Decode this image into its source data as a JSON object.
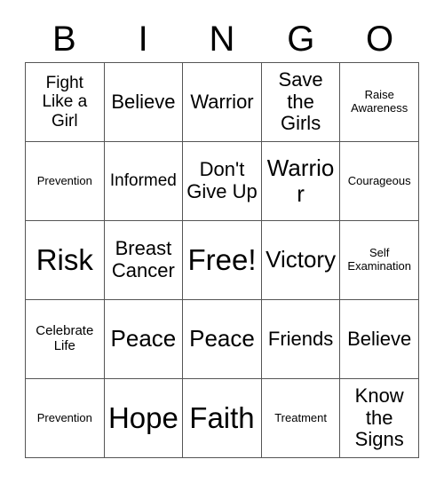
{
  "header": {
    "letters": [
      "B",
      "I",
      "N",
      "G",
      "O"
    ]
  },
  "grid": {
    "rows": 5,
    "columns": 5,
    "border_color": "#555555",
    "background_color": "#ffffff",
    "text_color": "#000000",
    "cells": [
      {
        "text": "Fight Like a Girl",
        "size": "m",
        "free": false
      },
      {
        "text": "Believe",
        "size": "l",
        "free": false
      },
      {
        "text": "Warrior",
        "size": "l",
        "free": false
      },
      {
        "text": "Save the Girls",
        "size": "l",
        "free": false
      },
      {
        "text": "Raise Awareness",
        "size": "xs",
        "free": false
      },
      {
        "text": "Prevention",
        "size": "xs",
        "free": false
      },
      {
        "text": "Informed",
        "size": "m",
        "free": false
      },
      {
        "text": "Don't Give Up",
        "size": "l",
        "free": false
      },
      {
        "text": "Warrior",
        "size": "xl",
        "free": false
      },
      {
        "text": "Courageous",
        "size": "xs",
        "free": false
      },
      {
        "text": "Risk",
        "size": "xxl",
        "free": false
      },
      {
        "text": "Breast Cancer",
        "size": "l",
        "free": false
      },
      {
        "text": "Free!",
        "size": "xxl",
        "free": true
      },
      {
        "text": "Victory",
        "size": "xl",
        "free": false
      },
      {
        "text": "Self Examination",
        "size": "xs",
        "free": false
      },
      {
        "text": "Celebrate Life",
        "size": "s",
        "free": false
      },
      {
        "text": "Peace",
        "size": "xl",
        "free": false
      },
      {
        "text": "Peace",
        "size": "xl",
        "free": false
      },
      {
        "text": "Friends",
        "size": "l",
        "free": false
      },
      {
        "text": "Believe",
        "size": "l",
        "free": false
      },
      {
        "text": "Prevention",
        "size": "xs",
        "free": false
      },
      {
        "text": "Hope",
        "size": "xxl",
        "free": false
      },
      {
        "text": "Faith",
        "size": "xxl",
        "free": false
      },
      {
        "text": "Treatment",
        "size": "xs",
        "free": false
      },
      {
        "text": "Know the Signs",
        "size": "l",
        "free": false
      }
    ]
  }
}
